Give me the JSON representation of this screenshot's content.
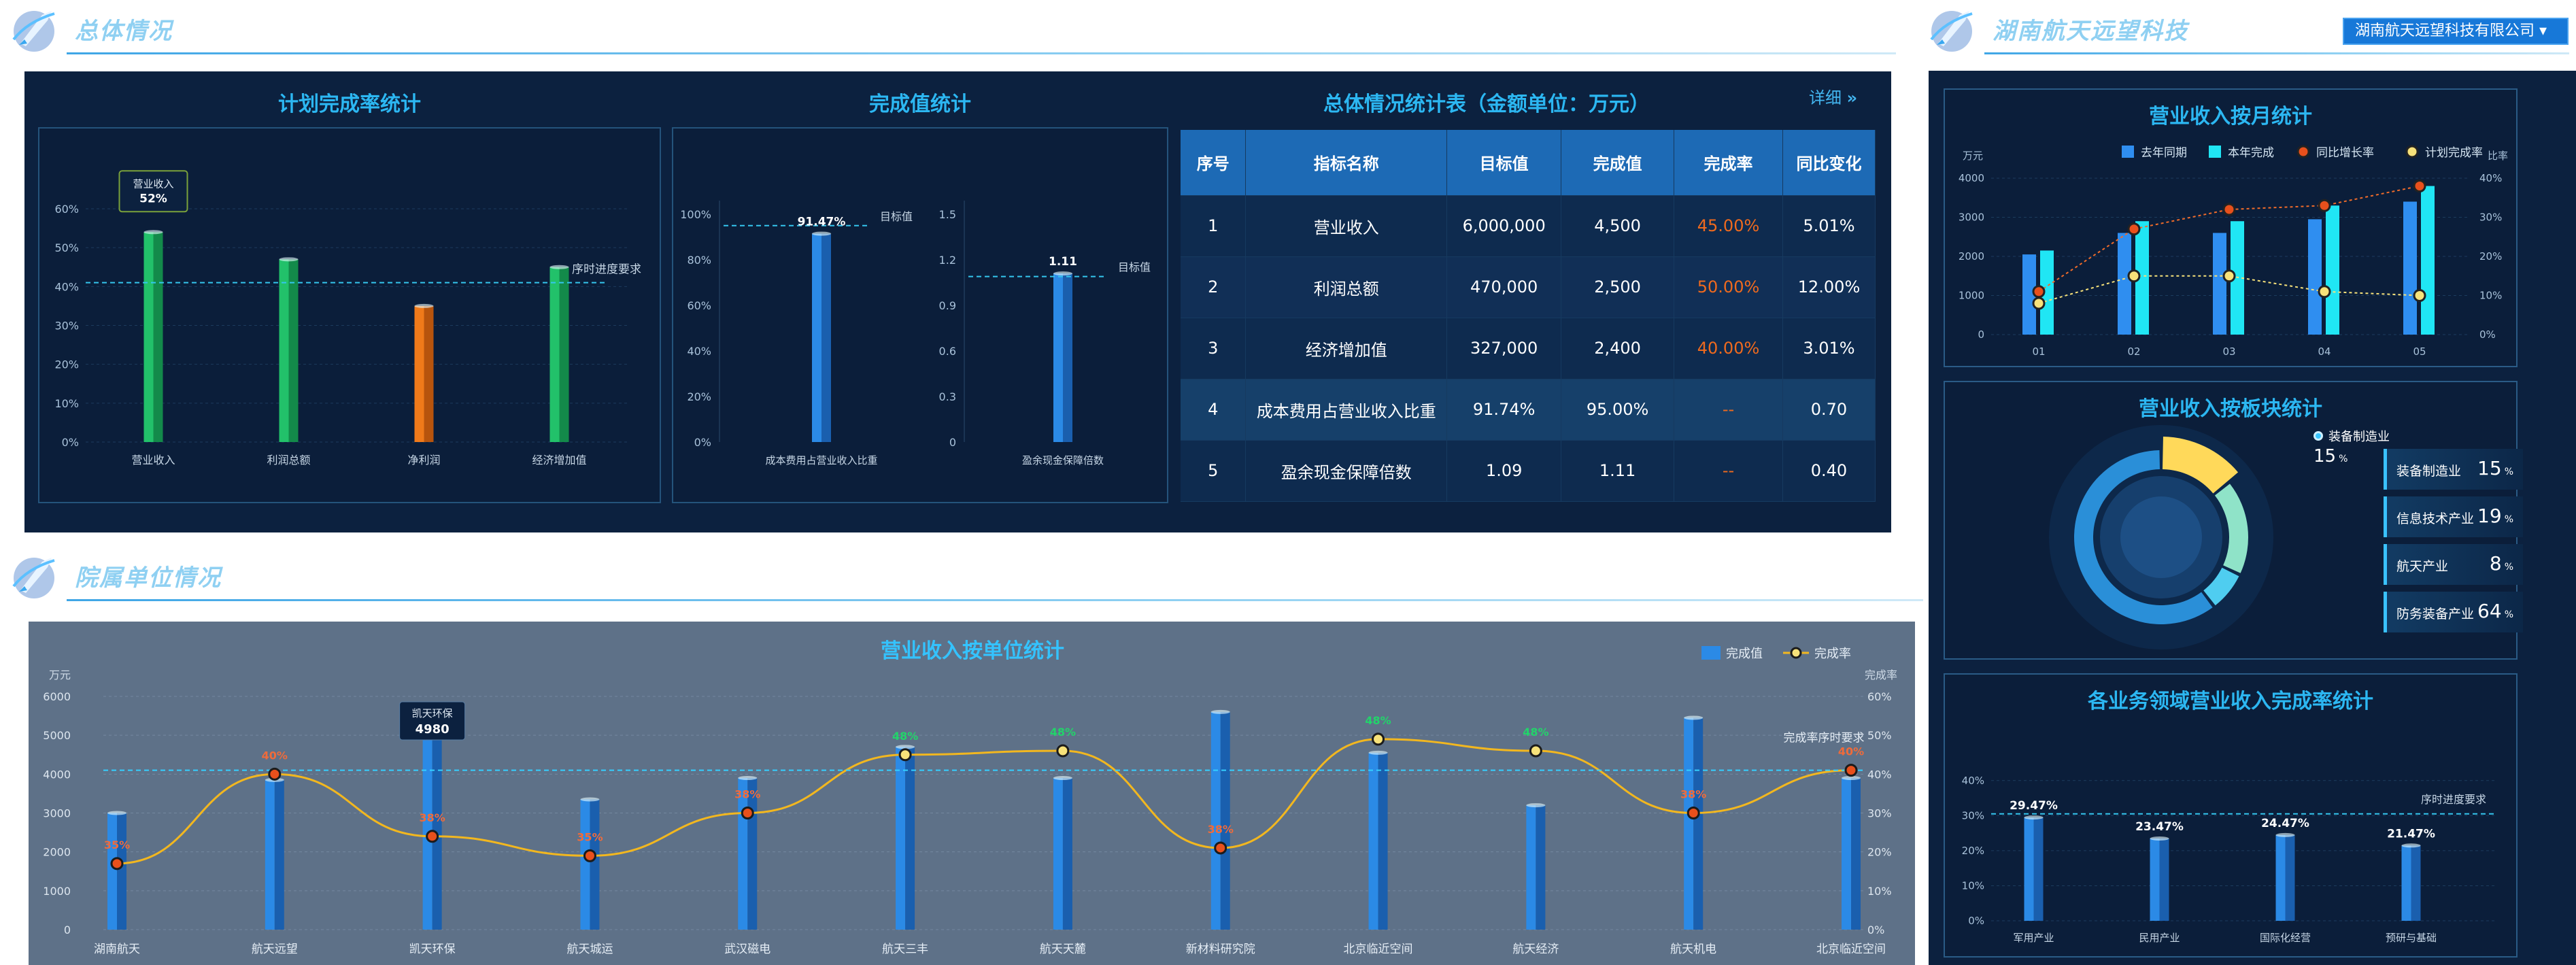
{
  "header": {
    "section1_title": "总体情况",
    "section2_title": "院属单位情况",
    "right_title": "湖南航天远望科技",
    "company_select": "湖南航天远望科技有限公司 ▾"
  },
  "plan_chart": {
    "title": "计划完成率统计",
    "yticks": [
      "60%",
      "50%",
      "40%",
      "30%",
      "20%",
      "10%",
      "0%"
    ],
    "progress_label": "序时进度要求",
    "categories": [
      "营业收入",
      "利润总额",
      "净利润",
      "经济增加值"
    ],
    "tooltip_name": "营业收入",
    "tooltip_value": "52%"
  },
  "done_chart": {
    "title": "完成值统计",
    "left_yticks": [
      "100%",
      "80%",
      "60%",
      "40%",
      "20%",
      "0%"
    ],
    "right_yticks": [
      "1.5",
      "1.2",
      "0.9",
      "0.6",
      "0.3",
      "0"
    ],
    "left_value": "91.47%",
    "right_value": "1.11",
    "target_label": "目标值",
    "left_category": "成本费用占营业收入比重",
    "right_category": "盈余现金保障倍数"
  },
  "summary_table": {
    "title": "总体情况统计表（金额单位：万元）",
    "detail_link": "详细",
    "headers": [
      "序号",
      "指标名称",
      "目标值",
      "完成值",
      "完成率",
      "同比变化"
    ],
    "rows": [
      [
        "1",
        "营业收入",
        "6,000,000",
        "4,500",
        "45.00%",
        "5.01%"
      ],
      [
        "2",
        "利润总额",
        "470,000",
        "2,500",
        "50.00%",
        "12.00%"
      ],
      [
        "3",
        "经济增加值",
        "327,000",
        "2,400",
        "40.00%",
        "3.01%"
      ],
      [
        "4",
        "成本费用占营业收入比重",
        "91.74%",
        "95.00%",
        "--",
        "0.70"
      ],
      [
        "5",
        "盈余现金保障倍数",
        "1.09",
        "1.11",
        "--",
        "0.40"
      ]
    ]
  },
  "unit_chart": {
    "title": "营业收入按单位统计",
    "legend_bar": "完成值",
    "legend_line": "完成率",
    "y_left_unit": "万元",
    "y_right_unit": "完成率",
    "y_left_ticks": [
      "6000",
      "5000",
      "4000",
      "3000",
      "2000",
      "1000",
      "0"
    ],
    "y_right_ticks": [
      "60%",
      "50%",
      "40%",
      "30%",
      "20%",
      "10%",
      "0%"
    ],
    "progress_label": "完成率序时要求",
    "tooltip_name": "凯天环保",
    "tooltip_value": "4980"
  },
  "monthly_chart": {
    "title": "营业收入按月统计",
    "unit_left": "万元",
    "unit_right": "比率",
    "legend": [
      "去年同期",
      "本年完成",
      "同比增长率",
      "计划完成率"
    ],
    "y_left_ticks": [
      "4000",
      "3000",
      "2000",
      "1000",
      "0"
    ],
    "y_right_ticks": [
      "40%",
      "30%",
      "20%",
      "10%",
      "0%"
    ]
  },
  "segment_chart": {
    "title": "营业收入按板块统计",
    "highlight_name": "装备制造业",
    "highlight_value": "15",
    "highlight_unit": "%",
    "items": [
      {
        "name": "装备制造业",
        "value": "15",
        "unit": "%"
      },
      {
        "name": "信息技术产业",
        "value": "19",
        "unit": "%"
      },
      {
        "name": "航天产业",
        "value": "8",
        "unit": "%"
      },
      {
        "name": "防务装备产业",
        "value": "64",
        "unit": "%"
      }
    ]
  },
  "domain_chart": {
    "title": "各业务领域营业收入完成率统计",
    "yticks": [
      "40%",
      "30%",
      "20%",
      "10%",
      "0%"
    ],
    "progress_label": "序时进度要求"
  },
  "chart_data": [
    {
      "type": "bar",
      "title": "计划完成率统计",
      "categories": [
        "营业收入",
        "利润总额",
        "净利润",
        "经济增加值"
      ],
      "values": [
        0.54,
        0.47,
        0.35,
        0.45
      ],
      "colors": [
        "#22c16a",
        "#22c16a",
        "#f07a1a",
        "#22c16a"
      ],
      "reference_line": 0.41,
      "ylim": [
        0,
        0.6
      ]
    },
    {
      "type": "bar",
      "title": "完成值统计",
      "categories": [
        "成本费用占营业收入比重",
        "盈余现金保障倍数"
      ],
      "values": [
        0.9147,
        1.11
      ],
      "targets": [
        0.95,
        1.09
      ],
      "ylims": [
        [
          0,
          1.0
        ],
        [
          0,
          1.5
        ]
      ]
    },
    {
      "type": "bar",
      "title": "营业收入按单位统计",
      "categories": [
        "湖南航天",
        "航天远望",
        "凯天环保",
        "航天城运",
        "武汉磁电",
        "航天三丰",
        "航天天麓",
        "新材料研究院",
        "北京临近空间",
        "航天经济",
        "航天机电",
        "北京临近空间"
      ],
      "series": [
        {
          "name": "完成值",
          "values": [
            3000,
            3850,
            4980,
            3350,
            3900,
            4700,
            3900,
            5600,
            4550,
            3200,
            5450,
            3900
          ]
        },
        {
          "name": "完成率",
          "values": [
            0.17,
            0.4,
            0.24,
            0.19,
            0.3,
            0.45,
            0.46,
            0.21,
            0.49,
            0.46,
            0.3,
            0.41
          ]
        }
      ],
      "rate_labels": [
        "35%",
        "40%",
        "38%",
        "35%",
        "38%",
        "48%",
        "48%",
        "38%",
        "48%",
        "48%",
        "38%",
        "40%"
      ],
      "rate_label_colors": [
        "#f06b3a",
        "#f06b3a",
        "#f06b3a",
        "#f06b3a",
        "#f06b3a",
        "#22d46a",
        "#22d46a",
        "#f06b3a",
        "#22d46a",
        "#22d46a",
        "#f06b3a",
        "#f06b3a"
      ],
      "reference_line": 0.41,
      "ylim": [
        0,
        6000
      ]
    },
    {
      "type": "bar",
      "title": "营业收入按月统计",
      "categories": [
        "01",
        "02",
        "03",
        "04",
        "05"
      ],
      "series": [
        {
          "name": "去年同期",
          "values": [
            2050,
            2600,
            2600,
            2950,
            3400
          ]
        },
        {
          "name": "本年完成",
          "values": [
            2150,
            2900,
            2900,
            3300,
            3800
          ]
        },
        {
          "name": "同比增长率",
          "values": [
            0.11,
            0.27,
            0.32,
            0.33,
            0.38
          ]
        },
        {
          "name": "计划完成率",
          "values": [
            0.08,
            0.15,
            0.15,
            0.11,
            0.1
          ]
        }
      ],
      "ylim": [
        0,
        4000
      ]
    },
    {
      "type": "pie",
      "title": "营业收入按板块统计",
      "categories": [
        "装备制造业",
        "信息技术产业",
        "航天产业",
        "防务装备产业"
      ],
      "values": [
        15,
        19,
        8,
        64
      ]
    },
    {
      "type": "bar",
      "title": "各业务领域营业收入完成率统计",
      "categories": [
        "军用产业",
        "民用产业",
        "国际化经营",
        "预研与基础"
      ],
      "values": [
        0.2947,
        0.2347,
        0.2447,
        0.2147
      ],
      "labels": [
        "29.47%",
        "23.47%",
        "24.47%",
        "21.47%"
      ],
      "reference_line": 0.305,
      "ylim": [
        0,
        0.45
      ]
    }
  ]
}
